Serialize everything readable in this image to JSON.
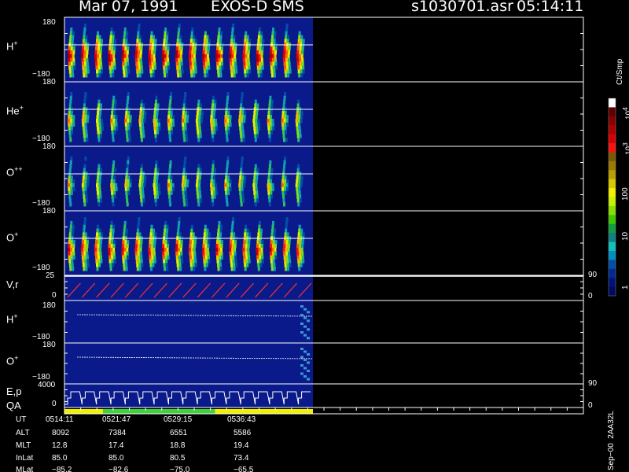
{
  "header": {
    "date": "Mar 07, 1991",
    "instrument": "EXOS-D SMS",
    "file": "s1030701.asr",
    "time": "05:14:11"
  },
  "panels": {
    "h_plus": {
      "name": "H",
      "sup": "+"
    },
    "he_plus": {
      "name": "He",
      "sup": "+"
    },
    "o_pp": {
      "name": "O",
      "sup": "++"
    },
    "o_plus": {
      "name": "O",
      "sup": "+"
    },
    "vr": {
      "name": "V,r"
    },
    "h_plus2": {
      "name": "H",
      "sup": "+"
    },
    "o_plus2": {
      "name": "O",
      "sup": "+"
    },
    "ep": {
      "name": "E,p"
    },
    "qa": {
      "name": "QA"
    }
  },
  "ticks": {
    "pos180": "180",
    "neg180": "−180",
    "v25": "25",
    "zero": "0",
    "e4000": "4000",
    "right90": "90",
    "right0": "0"
  },
  "colorbar": {
    "unit": "Ct/Smp",
    "labels": {
      "t10e4": "10",
      "t10e4_exp": "4",
      "t10e3": "10",
      "t10e3_exp": "3",
      "t100": "100",
      "t10": "10",
      "t1": "1"
    },
    "colors": [
      "#ffffff",
      "#600000",
      "#8a0000",
      "#b00000",
      "#d80000",
      "#ff1010",
      "#7a5a00",
      "#9a7a00",
      "#b8a000",
      "#d8c800",
      "#f0f000",
      "#c8f000",
      "#88e000",
      "#40c800",
      "#10a040",
      "#108080",
      "#10c0c0",
      "#0090c0",
      "#0050a8",
      "#002a90",
      "#001478",
      "#000a60"
    ]
  },
  "ephemeris": {
    "rows": [
      "UT",
      "ALT",
      "MLT",
      "InLat",
      "MLat"
    ],
    "columns": [
      [
        "0514:11",
        "8092",
        "12.8",
        "85.0",
        "−85.2"
      ],
      [
        "0521:47",
        "7384",
        "17.4",
        "85.0",
        "−82.6"
      ],
      [
        "0529:15",
        "6551",
        "18.8",
        "80.5",
        "−75.0"
      ],
      [
        "0536:43",
        "5586",
        "19.4",
        "73.4",
        "−65.5"
      ]
    ]
  },
  "footer_id": "Sep−00  2AA32L",
  "colors": {
    "background": "#000000",
    "plot_bg": "#0a1a8a",
    "axis": "#ffffff",
    "vr_trace": "#ff3030",
    "qa_yellow": "#f0f000",
    "qa_green": "#40d040"
  },
  "chart_data": {
    "type": "heatmap",
    "title": "Mar 07, 1991   EXOS-D SMS",
    "x_time_labels": [
      "0514:11",
      "0521:47",
      "0529:15",
      "0536:43"
    ],
    "panels": [
      {
        "name": "H+",
        "ylim": [
          -180,
          180
        ],
        "pulses": 18,
        "peak_level": 0.95
      },
      {
        "name": "He+",
        "ylim": [
          -180,
          180
        ],
        "pulses": 17,
        "peak_level": 0.65
      },
      {
        "name": "O++",
        "ylim": [
          -180,
          180
        ],
        "pulses": 17,
        "peak_level": 0.6
      },
      {
        "name": "O+",
        "ylim": [
          -180,
          180
        ],
        "pulses": 18,
        "peak_level": 0.85
      },
      {
        "name": "V,r",
        "ylim": [
          0,
          25
        ],
        "right_ylim": [
          0,
          90
        ]
      },
      {
        "name": "H+",
        "ylim": [
          -180,
          180
        ]
      },
      {
        "name": "O+",
        "ylim": [
          -180,
          180
        ]
      },
      {
        "name": "E,p",
        "ylim": [
          0,
          4000
        ],
        "right_ylim": [
          0,
          90
        ]
      }
    ],
    "qa_segments": [
      {
        "from": 0.0,
        "to": 0.155,
        "color": "yellow"
      },
      {
        "from": 0.155,
        "to": 0.605,
        "color": "green"
      },
      {
        "from": 0.605,
        "to": 1.0,
        "color": "yellow"
      }
    ],
    "colorbar_scale": {
      "type": "log",
      "range": [
        1,
        10000
      ]
    }
  }
}
